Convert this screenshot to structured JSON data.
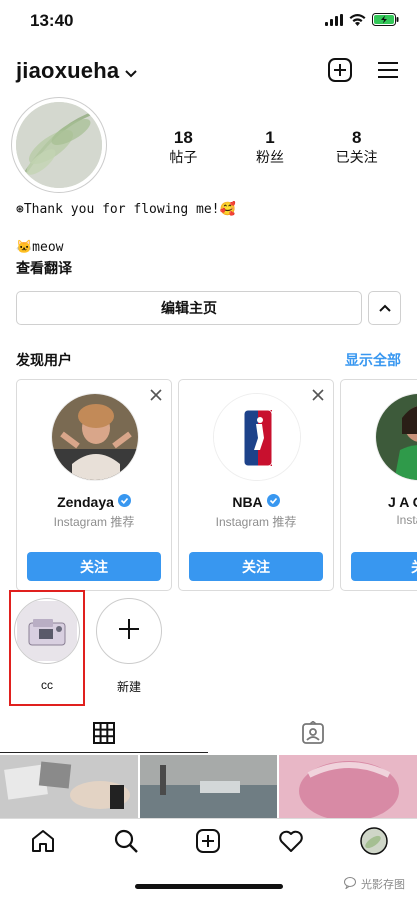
{
  "status_bar": {
    "time": "13:40"
  },
  "header": {
    "username": "jiaoxueha"
  },
  "profile": {
    "stats": [
      {
        "num": "18",
        "label": "帖子"
      },
      {
        "num": "1",
        "label": "粉丝"
      },
      {
        "num": "8",
        "label": "已关注"
      }
    ],
    "bio_line1": "⊛Thank you for flowing me!🥰",
    "bio_line2": "🐱meow",
    "translate": "查看翻译",
    "edit_label": "编辑主页"
  },
  "discover": {
    "title": "发现用户",
    "see_all": "显示全部",
    "cards": [
      {
        "name": "Zendaya",
        "verified": true,
        "sub": "Instagram 推荐",
        "follow": "关注"
      },
      {
        "name": "NBA",
        "verified": true,
        "sub": "Instagram 推荐",
        "follow": "关注"
      },
      {
        "name": "J A C L Y",
        "verified": false,
        "sub": "Instagra",
        "follow": "关"
      }
    ]
  },
  "highlights": [
    {
      "label": "cc"
    },
    {
      "label": "新建"
    }
  ],
  "colors": {
    "accent": "#3897f0",
    "highlight_border": "#e0201e"
  },
  "watermark": "光影存图"
}
